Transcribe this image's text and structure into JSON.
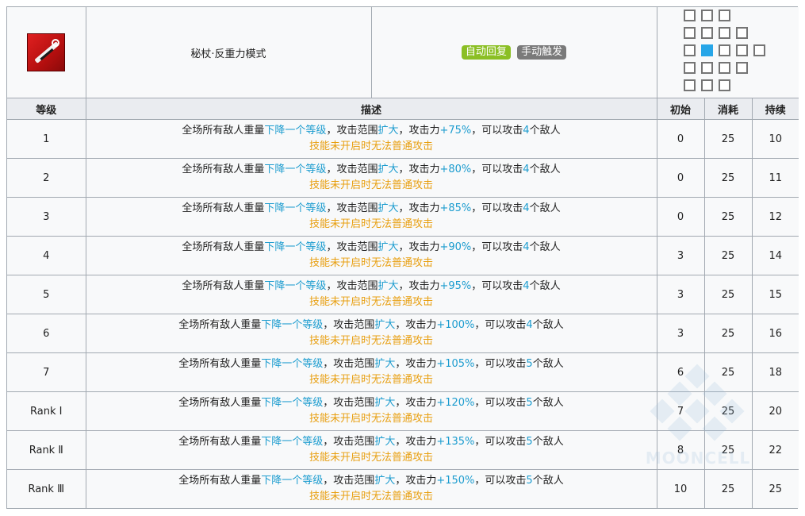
{
  "skill": {
    "name": "秘杖·反重力模式",
    "icon": "anti-gravity-wand-icon",
    "tags": [
      {
        "label": "自动回复",
        "color": "#8bbf24"
      },
      {
        "label": "手动触发",
        "color": "#7a7a7a"
      }
    ]
  },
  "range": {
    "rows": [
      [
        1,
        1,
        1,
        0,
        0
      ],
      [
        1,
        1,
        1,
        1,
        0
      ],
      [
        1,
        2,
        1,
        1,
        1
      ],
      [
        1,
        1,
        1,
        1,
        0
      ],
      [
        1,
        1,
        1,
        0,
        0
      ]
    ],
    "self_color": "#27a6e8"
  },
  "headers": {
    "level": "等级",
    "description": "描述",
    "initial": "初始",
    "cost": "消耗",
    "duration": "持续"
  },
  "common": {
    "prefix": "全场所有敌人重量",
    "weight_effect": "下降一个等级",
    "mid1": "，攻击范围",
    "range_effect": "扩大",
    "mid2": "，攻击力",
    "mid3": "，可以攻击",
    "suffix": "个敌人",
    "note": "技能未开启时无法普通攻击"
  },
  "levels": [
    {
      "level": "1",
      "atk": "+75%",
      "targets": "4",
      "initial": "0",
      "cost": "25",
      "duration": "10"
    },
    {
      "level": "2",
      "atk": "+80%",
      "targets": "4",
      "initial": "0",
      "cost": "25",
      "duration": "11"
    },
    {
      "level": "3",
      "atk": "+85%",
      "targets": "4",
      "initial": "0",
      "cost": "25",
      "duration": "12"
    },
    {
      "level": "4",
      "atk": "+90%",
      "targets": "4",
      "initial": "3",
      "cost": "25",
      "duration": "14"
    },
    {
      "level": "5",
      "atk": "+95%",
      "targets": "4",
      "initial": "3",
      "cost": "25",
      "duration": "15"
    },
    {
      "level": "6",
      "atk": "+100%",
      "targets": "4",
      "initial": "3",
      "cost": "25",
      "duration": "16"
    },
    {
      "level": "7",
      "atk": "+105%",
      "targets": "5",
      "initial": "6",
      "cost": "25",
      "duration": "18"
    },
    {
      "level": "Rank Ⅰ",
      "atk": "+120%",
      "targets": "5",
      "initial": "7",
      "cost": "25",
      "duration": "20"
    },
    {
      "level": "Rank Ⅱ",
      "atk": "+135%",
      "targets": "5",
      "initial": "8",
      "cost": "25",
      "duration": "22"
    },
    {
      "level": "Rank Ⅲ",
      "atk": "+150%",
      "targets": "5",
      "initial": "10",
      "cost": "25",
      "duration": "25"
    }
  ],
  "watermark": "MOONCELL"
}
